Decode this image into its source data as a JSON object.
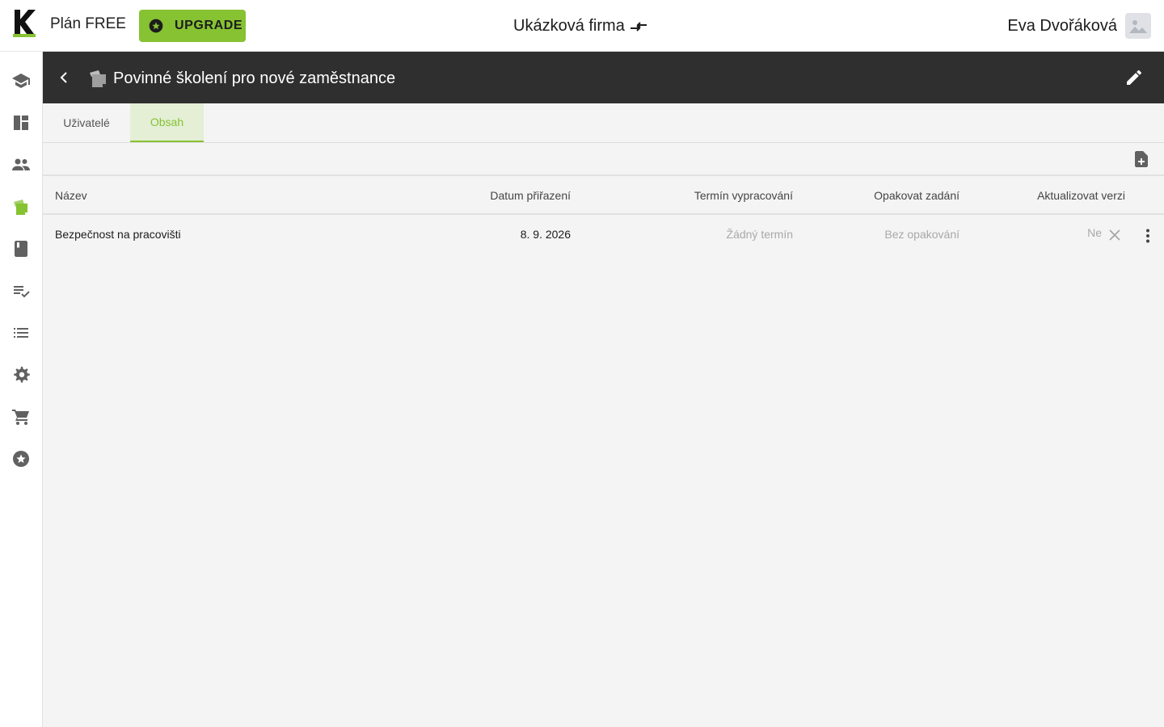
{
  "app": {
    "plan_label": "Plán FREE",
    "upgrade_label": "UPGRADE",
    "company_name": "Ukázková firma",
    "user_name": "Eva Dvořáková",
    "accent_color": "#86c232"
  },
  "sidebar": {
    "items": [
      {
        "icon": "school-icon"
      },
      {
        "icon": "dashboard-icon"
      },
      {
        "icon": "people-icon"
      },
      {
        "icon": "courses-icon",
        "active": true
      },
      {
        "icon": "book-icon"
      },
      {
        "icon": "playlist-check-icon"
      },
      {
        "icon": "list-icon"
      },
      {
        "icon": "gear-icon"
      },
      {
        "icon": "cart-icon"
      },
      {
        "icon": "star-circle-icon"
      }
    ]
  },
  "header": {
    "title": "Povinné školení pro nové zaměstnance"
  },
  "tabs": [
    {
      "label": "Uživatelé",
      "active": false
    },
    {
      "label": "Obsah",
      "active": true
    }
  ],
  "table": {
    "columns": {
      "name": "Název",
      "assigned": "Datum přiřazení",
      "deadline": "Termín vypracování",
      "repeat": "Opakovat zadání",
      "update": "Aktualizovat verzi"
    },
    "rows": [
      {
        "name": "Bezpečnost na pracovišti",
        "assigned": "8. 9. 2026",
        "deadline": "Žádný termín",
        "repeat": "Bez opakování",
        "update": "Ne"
      }
    ]
  }
}
